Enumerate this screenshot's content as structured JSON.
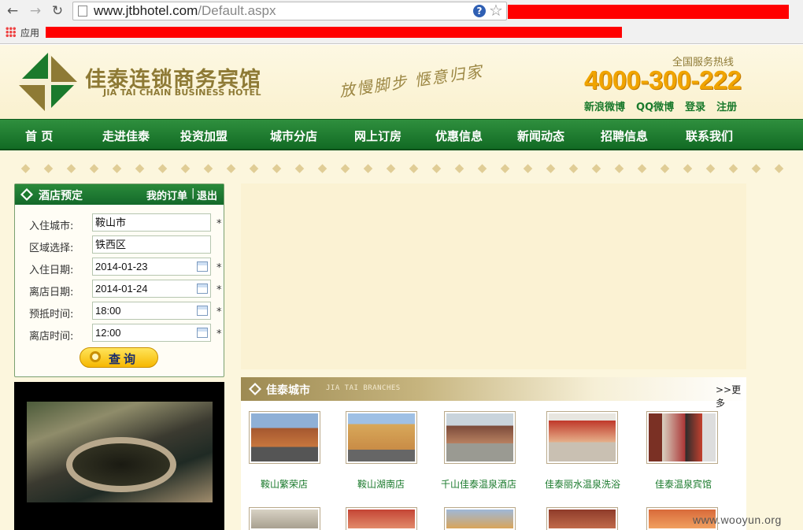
{
  "browser": {
    "url_host": "www.jtbhotel.com",
    "url_path": "/Default.aspx",
    "apps_label": "应用"
  },
  "header": {
    "brand_cn": "佳泰连锁商务宾馆",
    "brand_en": "JIA TAI CHAIN BUSINESS HOTEL",
    "slogan": "放慢脚步  惬意归家",
    "hotline_label": "全国服务热线",
    "hotline_number": "4000-300-222",
    "links": [
      "新浪微博",
      "QQ微博",
      "登录",
      "注册"
    ]
  },
  "nav": {
    "items": [
      "首  页",
      "走进佳泰",
      "投资加盟",
      "城市分店",
      "网上订房",
      "优惠信息",
      "新闻动态",
      "招聘信息",
      "联系我们"
    ]
  },
  "booking": {
    "title": "酒店预定",
    "my_orders": "我的订单",
    "separator": "|",
    "logout": "退出",
    "fields": [
      {
        "label": "入住城市:",
        "value": "鞍山市",
        "required": "*"
      },
      {
        "label": "区域选择:",
        "value": "铁西区",
        "required": ""
      },
      {
        "label": "入住日期:",
        "value": "2014-01-23",
        "required": "*"
      },
      {
        "label": "离店日期:",
        "value": "2014-01-24",
        "required": "*"
      },
      {
        "label": "预抵时间:",
        "value": "18:00",
        "required": "*"
      },
      {
        "label": "离店时间:",
        "value": "12:00",
        "required": "*"
      }
    ],
    "search_label": "查询"
  },
  "branches": {
    "title": "佳泰城市",
    "subtitle": "JIA TAI BRANCHES",
    "more": ">>更多",
    "items": [
      {
        "name": "鞍山繁荣店"
      },
      {
        "name": "鞍山湖南店"
      },
      {
        "name": "千山佳泰温泉酒店"
      },
      {
        "name": "佳泰丽水温泉洗浴"
      },
      {
        "name": "佳泰温泉宾馆"
      }
    ]
  },
  "watermark": "www.wooyun.org",
  "colors": {
    "nav_green": "#1a7a2c",
    "hotline_orange": "#f0a400",
    "brand_gold": "#8e7a35",
    "page_bg": "#fcf6dd"
  }
}
